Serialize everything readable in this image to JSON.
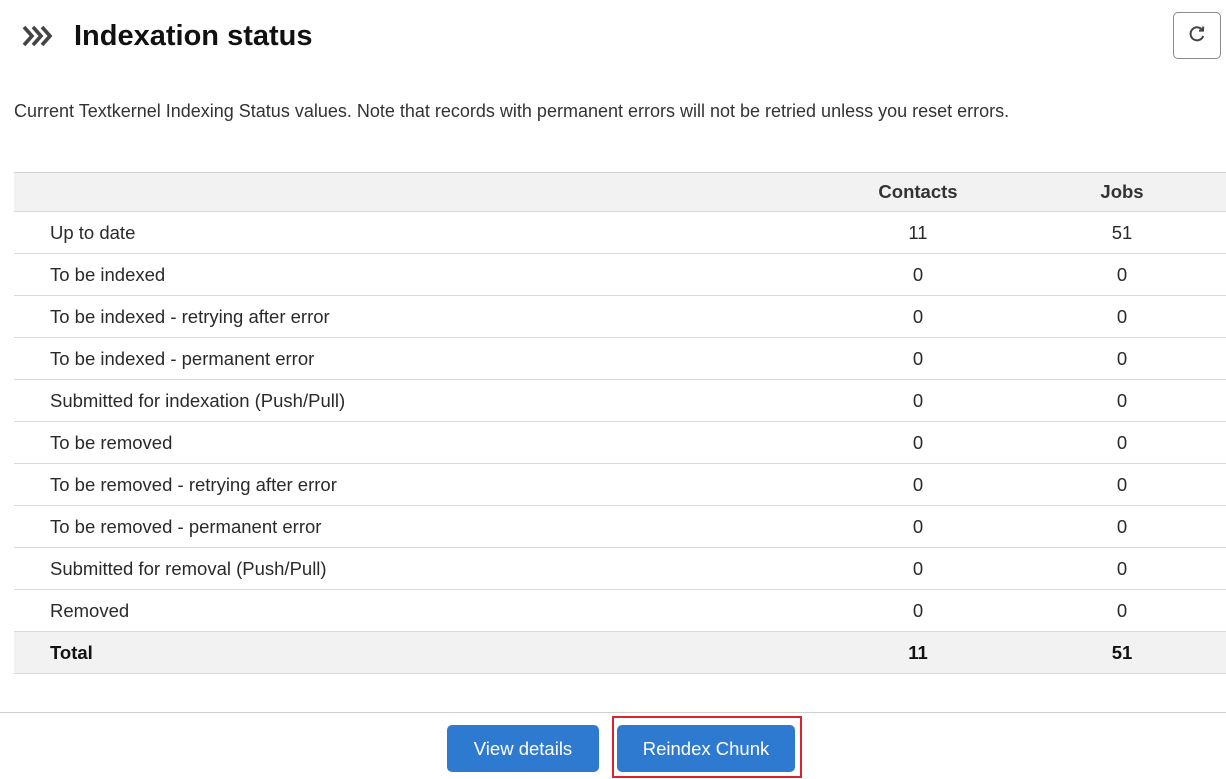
{
  "header": {
    "title": "Indexation status",
    "icon": "triple-chevron-right-icon",
    "refresh_icon": "refresh-icon"
  },
  "description": "Current Textkernel Indexing Status values. Note that records with permanent errors will not be retried unless you reset errors.",
  "table": {
    "columns": [
      "",
      "Contacts",
      "Jobs"
    ],
    "rows": [
      {
        "label": "Up to date",
        "contacts": "11",
        "jobs": "51"
      },
      {
        "label": "To be indexed",
        "contacts": "0",
        "jobs": "0"
      },
      {
        "label": "To be indexed - retrying after error",
        "contacts": "0",
        "jobs": "0"
      },
      {
        "label": "To be indexed - permanent error",
        "contacts": "0",
        "jobs": "0"
      },
      {
        "label": "Submitted for indexation (Push/Pull)",
        "contacts": "0",
        "jobs": "0"
      },
      {
        "label": "To be removed",
        "contacts": "0",
        "jobs": "0"
      },
      {
        "label": "To be removed - retrying after error",
        "contacts": "0",
        "jobs": "0"
      },
      {
        "label": "To be removed - permanent error",
        "contacts": "0",
        "jobs": "0"
      },
      {
        "label": "Submitted for removal (Push/Pull)",
        "contacts": "0",
        "jobs": "0"
      },
      {
        "label": "Removed",
        "contacts": "0",
        "jobs": "0"
      }
    ],
    "total": {
      "label": "Total",
      "contacts": "11",
      "jobs": "51"
    }
  },
  "footer": {
    "view_details_label": "View details",
    "reindex_chunk_label": "Reindex Chunk"
  },
  "colors": {
    "primary_button": "#2f7ad1",
    "highlight": "#d9232d",
    "header_row_bg": "#f2f2f2"
  }
}
